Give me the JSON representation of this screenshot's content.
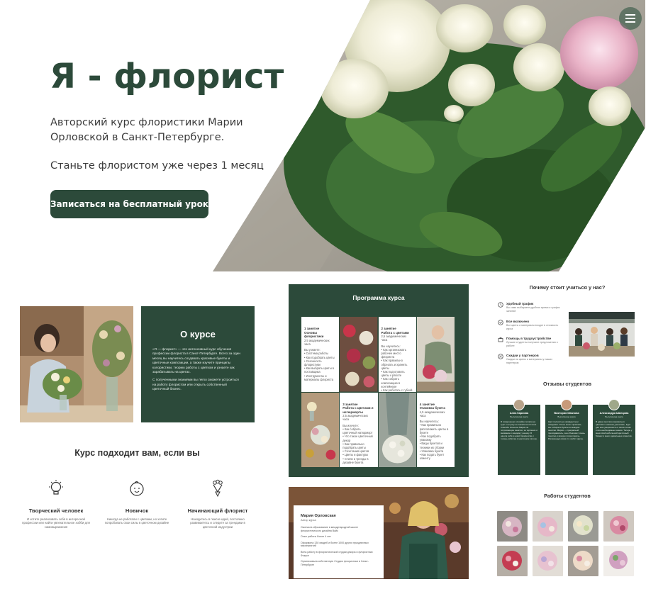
{
  "hero": {
    "title": "Я - флорист",
    "subtitle": "Авторский курс флористики Марии Орловской в Санкт-Петербурге.",
    "tagline": "Станьте флористом уже через 1 месяц",
    "cta_label": "Записаться на бесплатный урок"
  },
  "about": {
    "title": "О курсе",
    "text": "«Я — флорист» — это интенсивный курс обучения профессии флориста в Санкт-Петербурге. Всего за один месяц вы научитесь создавать красивые букеты и цветочные композиции, а также изучите принципы колористики, теорию работы с цветком и узнаете как зарабатывать на цветах.",
    "text2": "С полученными знаниями вы легко сможете устроиться на работу флористом или открыть собственный цветочный бизнес."
  },
  "suits": {
    "title": "Курс подходит вам, если вы",
    "items": [
      {
        "icon": "lightbulb-icon",
        "title": "Творческий человек",
        "desc": "И хотите реализовать себя в интересной профессии или найти увлекательное хобби для самовыражения"
      },
      {
        "icon": "baby-face-icon",
        "title": "Новичок",
        "desc": "Никогда не работали с цветами, но хотите попробовать свои силы в цветочном дизайне"
      },
      {
        "icon": "bouquet-icon",
        "title": "Начинающий флорист",
        "desc": "Находитесь в поиске идей, постоянно развиваетесь и следите за трендами в цветочной индустрии"
      }
    ]
  },
  "program": {
    "title": "Программа курса",
    "lessons": [
      {
        "title": "1 занятие\nОсновы флористики",
        "hours": "2,5 академических часа",
        "points": "Вы узнаете:\n• Система работы\n• Как подобрать цветы\n• Сезонность флористики\n• Как выбрать цветы в поставщика\n• Инструменты и материалы флориста"
      },
      {
        "title": "2 занятие\nРабота с цветами",
        "hours": "2,5 академических часа",
        "points": "Вы научитесь:\n• Как организовать рабочее место флориста\n• Как правильно обрезать и хранить цветы\n• Как подготовить цветы к работе\n• Как собрать композицию в контейнере\n• Как работать с губкой\n• Основы колористики"
      },
      {
        "title": "3 занятие\nРабота с цветами и натюрморты",
        "hours": "2,5 академических часа",
        "points": "Вы изучите:\n• Как собрать цветочный натюрморт\n• Что такое цветочный декор\n• Как правильно подобрать цветы\n• Сочетания цветов\n• Цветы и фактуры\n• Стили и тренды в дизайне букета"
      },
      {
        "title": "4 занятие\nУпаковка букета",
        "hours": "4,5 академических часа",
        "points": "Вы научитесь:\n• Как правильно расположить цветы в букете\n• Как подобрать упаковку\n• Виды букетов и техники их сборки\n• Упаковка букета\n• Как подать букет клиенту"
      }
    ]
  },
  "teacher": {
    "name": "Мария Орловская",
    "role": "Автор курса",
    "p1": "Окончила образование в международной школе флористического дизайна Вайк",
    "p2": "Опыт работы более 4 лет",
    "p3": "Оформила 130 свадеб и более 1000 других праздничных мероприятий",
    "p4": "Вела работу в флористической студии декора и флористики Фокусе",
    "p5": "Организовала собственную Студию флористики в Санкт-Петербурге"
  },
  "why": {
    "title": "Почему стоит учиться у нас?",
    "items": [
      {
        "icon": "clock-icon",
        "title": "Удобный график",
        "desc": "Вы сами выбираете удобное время и график занятий"
      },
      {
        "icon": "check-icon",
        "title": "Все включено",
        "desc": "Все цветы и материалы входят в стоимость курса"
      },
      {
        "icon": "briefcase-icon",
        "title": "Помощь в трудоустройстве",
        "desc": "Лучшие студенты получают предложения о работе"
      },
      {
        "icon": "percent-icon",
        "title": "Скидки у партнеров",
        "desc": "Скидки на цветы и материалы у наших партнеров"
      }
    ]
  },
  "reviews": {
    "title": "Отзывы студентов",
    "items": [
      {
        "name": "Анна Карлова",
        "role": "Выпускница курса",
        "text": "Я совершенно случайно попала на курс и ни разу не пожалела об этом. Спасибо большое Марии за потрясающие занятия, за терпение и внимание к каждому ученику. Я нашла себя в новой профессии и теперь работаю в цветочном салоне."
      },
      {
        "name": "Виктория Иванова",
        "role": "Выпускница курса",
        "text": "Курс полностью оправдал мои ожидания. Очень много практики, мы собирали букеты на каждом занятии. Мария — прекрасный преподаватель, она объясняет очень понятно и всегда готова помочь. Рекомендую всем кто любит цветы."
      },
      {
        "name": "Александра Швецова",
        "role": "Выпускница курса",
        "text": "Я давно мечтала заниматься цветами и наконец решилась. Курс дал мне уверенность в своих силах и все необходимые знания. Теперь у меня свой небольшой цветочный бизнес и много довольных клиентов."
      }
    ]
  },
  "works": {
    "title": "Работы студентов"
  },
  "colors": {
    "brand": "#2c4a3a",
    "text": "#333333"
  }
}
